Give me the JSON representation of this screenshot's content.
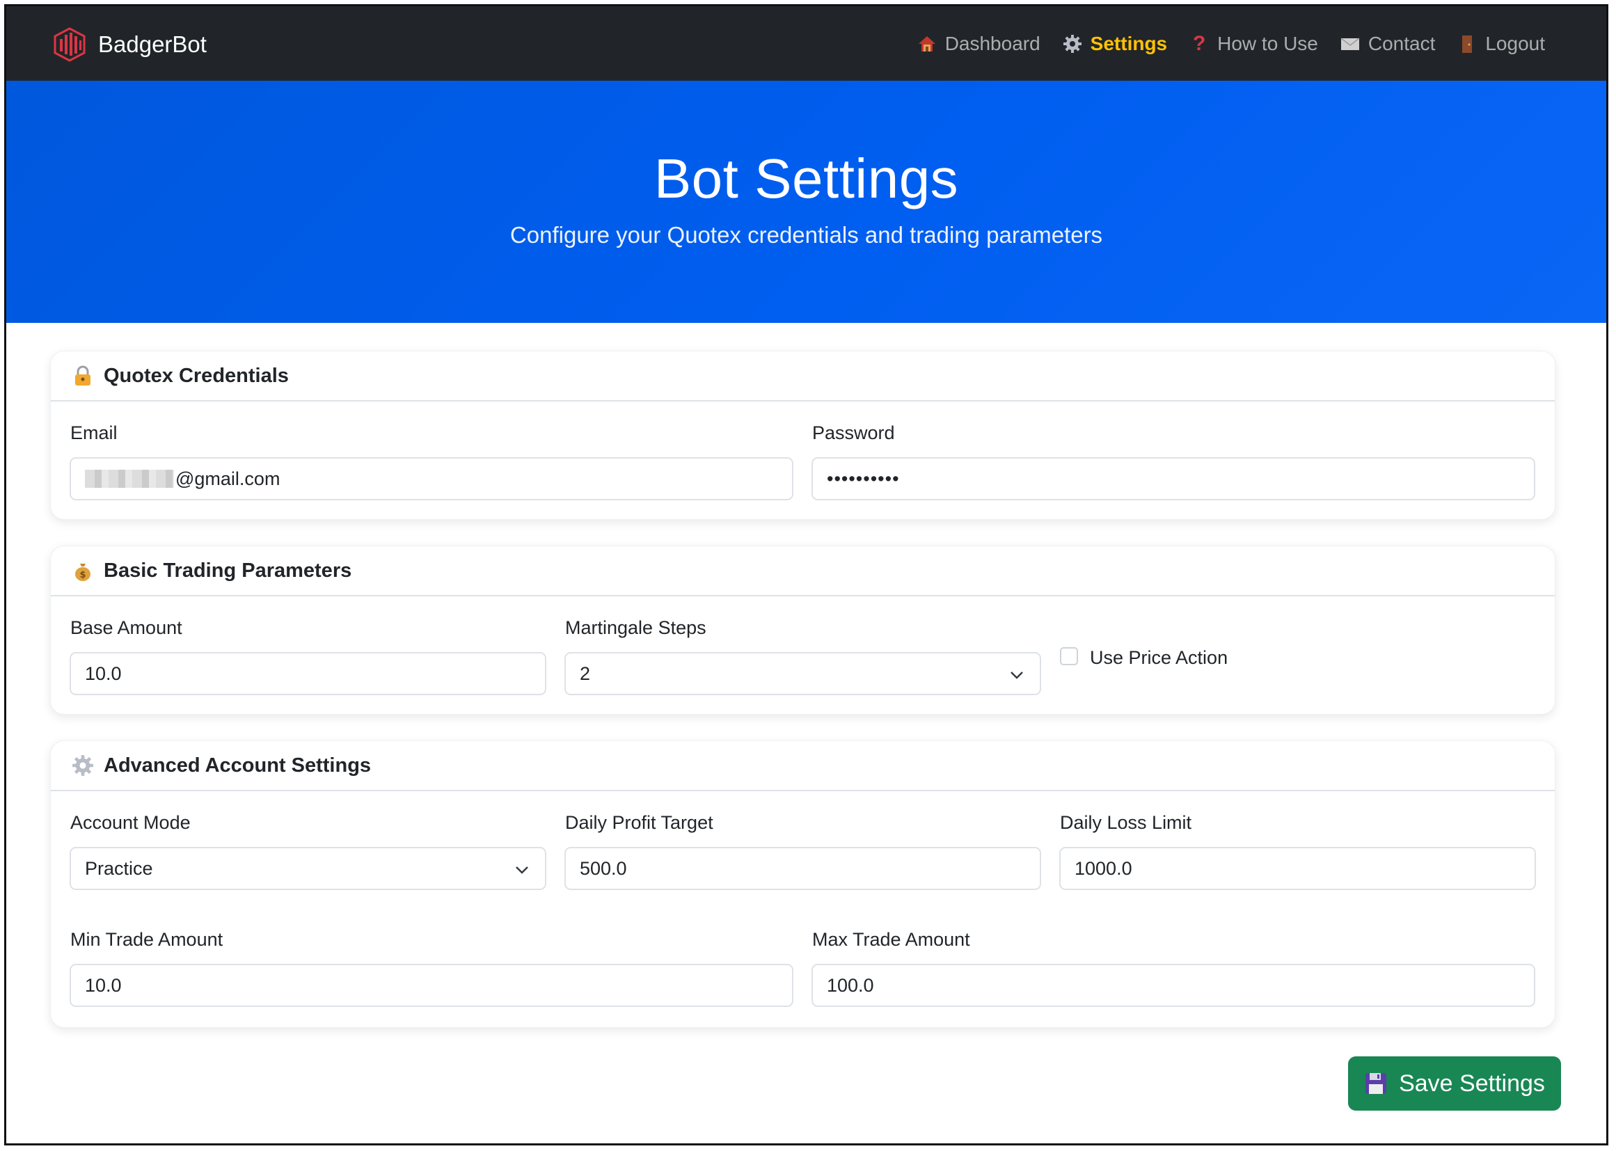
{
  "brand": {
    "name": "BadgerBot",
    "logo_icon": "badger-bars-logo",
    "logo_color": "#dc3545"
  },
  "nav": {
    "items": [
      {
        "label": "Dashboard",
        "icon": "house-icon",
        "active": false
      },
      {
        "label": "Settings",
        "icon": "gear-icon",
        "active": true
      },
      {
        "label": "How to Use",
        "icon": "question-icon",
        "active": false
      },
      {
        "label": "Contact",
        "icon": "envelope-icon",
        "active": false
      },
      {
        "label": "Logout",
        "icon": "door-icon",
        "active": false
      }
    ],
    "active_color": "#ffc107"
  },
  "hero": {
    "title": "Bot Settings",
    "subtitle": "Configure your Quotex credentials and trading parameters",
    "color": "#005ef0"
  },
  "credentials": {
    "title": "Quotex Credentials",
    "icon": "lock-icon",
    "email_label": "Email",
    "email_value": "@gmail.com",
    "password_label": "Password",
    "password_value": "••••••••••"
  },
  "basic": {
    "title": "Basic Trading Parameters",
    "icon": "money-bag-icon",
    "base_amount_label": "Base Amount",
    "base_amount_value": "10.0",
    "martingale_label": "Martingale Steps",
    "martingale_value": "2",
    "price_action_label": "Use Price Action",
    "price_action_checked": false
  },
  "advanced": {
    "title": "Advanced Account Settings",
    "icon": "gear-icon",
    "account_mode_label": "Account Mode",
    "account_mode_value": "Practice",
    "profit_target_label": "Daily Profit Target",
    "profit_target_value": "500.0",
    "loss_limit_label": "Daily Loss Limit",
    "loss_limit_value": "1000.0",
    "min_trade_label": "Min Trade Amount",
    "min_trade_value": "10.0",
    "max_trade_label": "Max Trade Amount",
    "max_trade_value": "100.0"
  },
  "save": {
    "label": "Save Settings",
    "icon": "floppy-disk-icon",
    "color": "#198754"
  }
}
